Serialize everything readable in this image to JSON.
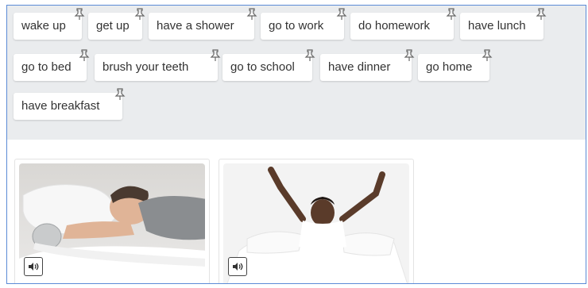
{
  "word_bank": {
    "chips": [
      {
        "label": "wake up"
      },
      {
        "label": "get up"
      },
      {
        "label": "have a shower"
      },
      {
        "label": "go to work"
      },
      {
        "label": "do homework"
      },
      {
        "label": "have lunch"
      },
      {
        "label": "go to bed"
      },
      {
        "label": "brush your teeth"
      },
      {
        "label": "go to school"
      },
      {
        "label": "have dinner"
      },
      {
        "label": "go home"
      },
      {
        "label": "have breakfast"
      }
    ],
    "drag_icon": "drag-pin-icon"
  },
  "cards": [
    {
      "image": "man-sleeping-alarm-clock",
      "audio_icon": "speaker-icon"
    },
    {
      "image": "woman-stretching-in-bed",
      "audio_icon": "speaker-icon"
    }
  ],
  "colors": {
    "bank_bg": "#eaecee",
    "frame_border": "#5b8bd6",
    "chip_text": "#333333"
  }
}
